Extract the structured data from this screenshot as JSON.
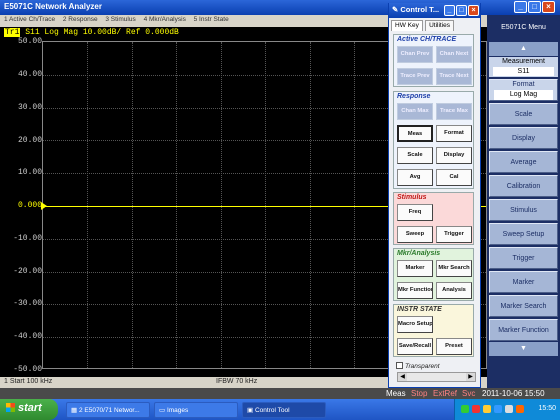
{
  "analyzer": {
    "title": "E5071C Network Analyzer",
    "menubar": [
      "1 Active Ch/Trace",
      "2 Response",
      "3 Stimulus",
      "4 Mkr/Analysis",
      "5 Instr State"
    ]
  },
  "plot": {
    "trace_badge": "Tr1",
    "trace_info": "S11 Log Mag 10.00dB/ Ref 0.000dB",
    "y_labels": [
      "50.00",
      "40.00",
      "30.00",
      "20.00",
      "10.00",
      "0.000",
      "-10.00",
      "-20.00",
      "-30.00",
      "-40.00",
      "-50.00"
    ],
    "reference_label": "0.000"
  },
  "statusbar": {
    "start": "1 Start 100 kHz",
    "ifbw": "IFBW 70 kHz"
  },
  "infobar": {
    "meas": "Meas",
    "stop": "Stop",
    "extref": "ExtRef",
    "svc": "Svc",
    "datetime": "2011-10-06 15:50"
  },
  "softkey_menu": {
    "title": "E5071C Menu",
    "measurement_label": "Measurement",
    "measurement_value": "S11",
    "format_label": "Format",
    "format_value": "Log Mag",
    "items": [
      "Scale",
      "Display",
      "Average",
      "Calibration",
      "Stimulus",
      "Sweep Setup",
      "Trigger",
      "Marker",
      "Marker Search",
      "Marker Function"
    ]
  },
  "control_tool": {
    "title": "Control T...",
    "tabs": [
      "HW Key",
      "Utilities"
    ],
    "active_group": {
      "title": "Active CH/TRACE",
      "buttons": [
        "Chan Prev",
        "Chan Next",
        "Trace Prev",
        "Trace Next"
      ]
    },
    "response_group": {
      "title": "Response",
      "buttons": [
        "Chan Max",
        "Trace Max",
        "Meas",
        "Format",
        "Scale",
        "Display",
        "Avg",
        "Cal"
      ]
    },
    "stimulus_group": {
      "title": "Stimulus",
      "buttons": [
        "Freq",
        "Sweep",
        "Trigger"
      ]
    },
    "mkr_group": {
      "title": "Mkr/Analysis",
      "buttons": [
        "Marker",
        "Mkr Search",
        "Mkr Function",
        "Analysis"
      ]
    },
    "instr_group": {
      "title": "INSTR STATE",
      "buttons": [
        "Macro Setup",
        "Save/Recall",
        "Preset"
      ]
    },
    "transparent_label": "Transparent"
  },
  "taskbar": {
    "start_label": "start",
    "tasks": [
      "2 E5070/71 Networ...",
      "Images",
      "Control Tool"
    ],
    "clock": "15:50"
  },
  "colors": {
    "trace": "#ffff00",
    "menu_bg": "#1c2e64",
    "taskbar": "#1f55c4"
  }
}
